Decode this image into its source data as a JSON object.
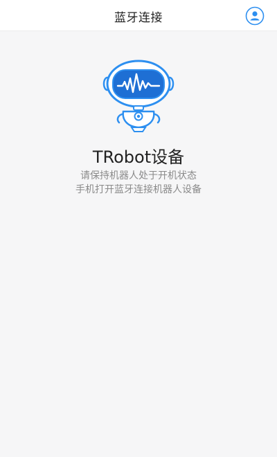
{
  "header": {
    "title": "蓝牙连接",
    "profile_icon": "user-icon"
  },
  "device": {
    "robot_icon": "robot-icon",
    "title": "TRobot设备",
    "hints": [
      "请保持机器人处于开机状态",
      "手机打开蓝牙连接机器人设备"
    ]
  },
  "colors": {
    "accent": "#2d8ff0",
    "background": "#f6f6f7",
    "hint_text": "#8a8a8a"
  }
}
